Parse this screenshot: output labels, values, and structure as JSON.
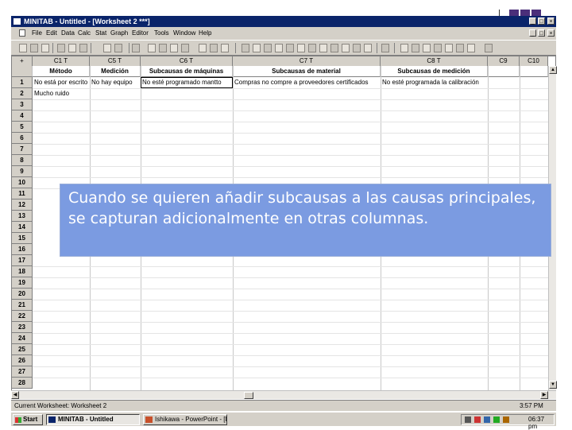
{
  "window": {
    "title": "MINITAB - Untitled - [Worksheet 2 ***]",
    "controls": [
      "_",
      "□",
      "×"
    ],
    "doc_controls": [
      "_",
      "□",
      "×"
    ]
  },
  "menu": [
    "File",
    "Edit",
    "Data",
    "Calc",
    "Stat",
    "Graph",
    "Editor",
    "Tools",
    "Window",
    "Help"
  ],
  "worksheet": {
    "column_ids": [
      "C1 T",
      "C5 T",
      "C6 T",
      "C7 T",
      "C8 T",
      "C9",
      "C10"
    ],
    "column_names": [
      "Método",
      "Medición",
      "Subcausas de máquinas",
      "Subcausas de material",
      "Subcausas de medición",
      "",
      ""
    ],
    "row_numbers": [
      "1",
      "2",
      "3",
      "4",
      "5",
      "6",
      "7",
      "8",
      "9",
      "10",
      "11",
      "12",
      "13",
      "14",
      "15",
      "16",
      "17",
      "18",
      "19",
      "20",
      "21",
      "22",
      "23",
      "24",
      "25",
      "26",
      "27",
      "28"
    ],
    "cells": {
      "r1_c1": "No está por escrito",
      "r1_c5": "No hay equipo",
      "r1_c6": "No esté programado mantto",
      "r1_c7": "Compras no compre a proveedores certificados",
      "r1_c8": "No esté programada la calibración",
      "r2_c1": "Mucho ruido"
    },
    "corner_label": "+"
  },
  "statusbar": {
    "text": "Current Worksheet: Worksheet 2",
    "time": "3:57 PM"
  },
  "taskbar": {
    "start": "Start",
    "tasks": [
      "MINITAB - Untitled",
      "Ishikawa - PowerPoint - [D..."
    ],
    "clock": "06:37 pm"
  },
  "callout": {
    "text": "Cuando se quieren añadir subcausas a las causas principales, se capturan adicionalmente en otras columnas."
  },
  "colors": {
    "titlebar": "#0a246a",
    "callout_bg": "#7b9be1",
    "deco_purple": "#4b2f7a"
  }
}
